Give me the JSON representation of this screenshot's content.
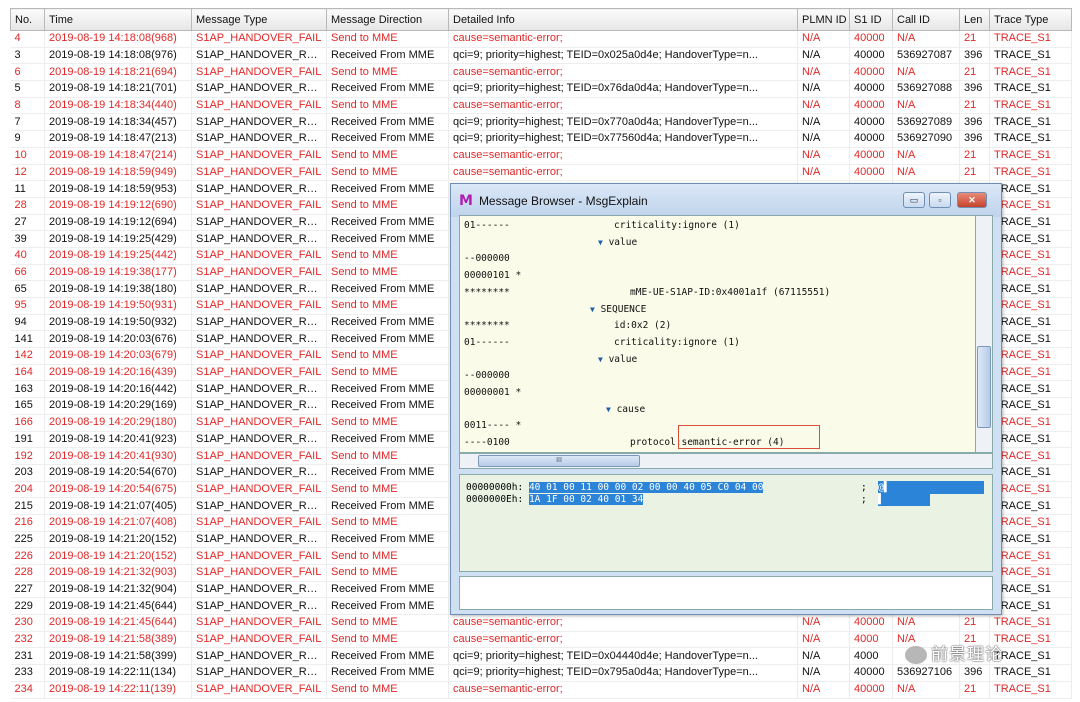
{
  "columns": [
    "No.",
    "Time",
    "Message Type",
    "Message Direction",
    "Detailed Info",
    "PLMN ID",
    "S1 ID",
    "Call ID",
    "Len",
    "Trace Type"
  ],
  "rows": [
    [
      "4",
      "2019-08-19 14:18:08(968)",
      "S1AP_HANDOVER_FAIL",
      "Send to MME",
      "cause=semantic-error;",
      "N/A",
      "40000",
      "N/A",
      "21",
      "TRACE_S1",
      "fail"
    ],
    [
      "3",
      "2019-08-19 14:18:08(976)",
      "S1AP_HANDOVER_REQ",
      "Received From MME",
      "qci=9; priority=highest; TEID=0x025a0d4e; HandoverType=n...",
      "N/A",
      "40000",
      "536927087",
      "396",
      "TRACE_S1",
      "req"
    ],
    [
      "6",
      "2019-08-19 14:18:21(694)",
      "S1AP_HANDOVER_FAIL",
      "Send to MME",
      "cause=semantic-error;",
      "N/A",
      "40000",
      "N/A",
      "21",
      "TRACE_S1",
      "fail"
    ],
    [
      "5",
      "2019-08-19 14:18:21(701)",
      "S1AP_HANDOVER_REQ",
      "Received From MME",
      "qci=9; priority=highest; TEID=0x76da0d4a; HandoverType=n...",
      "N/A",
      "40000",
      "536927088",
      "396",
      "TRACE_S1",
      "req"
    ],
    [
      "8",
      "2019-08-19 14:18:34(440)",
      "S1AP_HANDOVER_FAIL",
      "Send to MME",
      "cause=semantic-error;",
      "N/A",
      "40000",
      "N/A",
      "21",
      "TRACE_S1",
      "fail"
    ],
    [
      "7",
      "2019-08-19 14:18:34(457)",
      "S1AP_HANDOVER_REQ",
      "Received From MME",
      "qci=9; priority=highest; TEID=0x770a0d4a; HandoverType=n...",
      "N/A",
      "40000",
      "536927089",
      "396",
      "TRACE_S1",
      "req"
    ],
    [
      "9",
      "2019-08-19 14:18:47(213)",
      "S1AP_HANDOVER_REQ",
      "Received From MME",
      "qci=9; priority=highest; TEID=0x77560d4a; HandoverType=n...",
      "N/A",
      "40000",
      "536927090",
      "396",
      "TRACE_S1",
      "req"
    ],
    [
      "10",
      "2019-08-19 14:18:47(214)",
      "S1AP_HANDOVER_FAIL",
      "Send to MME",
      "cause=semantic-error;",
      "N/A",
      "40000",
      "N/A",
      "21",
      "TRACE_S1",
      "fail"
    ],
    [
      "12",
      "2019-08-19 14:18:59(949)",
      "S1AP_HANDOVER_FAIL",
      "Send to MME",
      "cause=semantic-error;",
      "N/A",
      "40000",
      "N/A",
      "21",
      "TRACE_S1",
      "fail"
    ],
    [
      "11",
      "2019-08-19 14:18:59(953)",
      "S1AP_HANDOVER_REQ",
      "Received From MME",
      "",
      "",
      "",
      "",
      "",
      "TRACE_S1",
      "req"
    ],
    [
      "28",
      "2019-08-19 14:19:12(690)",
      "S1AP_HANDOVER_FAIL",
      "Send to MME",
      "",
      "",
      "",
      "",
      "",
      "TRACE_S1",
      "fail"
    ],
    [
      "27",
      "2019-08-19 14:19:12(694)",
      "S1AP_HANDOVER_REQ",
      "Received From MME",
      "",
      "",
      "",
      "",
      "",
      "TRACE_S1",
      "req"
    ],
    [
      "39",
      "2019-08-19 14:19:25(429)",
      "S1AP_HANDOVER_REQ",
      "Received From MME",
      "",
      "",
      "",
      "",
      "",
      "TRACE_S1",
      "req"
    ],
    [
      "40",
      "2019-08-19 14:19:25(442)",
      "S1AP_HANDOVER_FAIL",
      "Send to MME",
      "",
      "",
      "",
      "",
      "",
      "TRACE_S1",
      "fail"
    ],
    [
      "66",
      "2019-08-19 14:19:38(177)",
      "S1AP_HANDOVER_FAIL",
      "Send to MME",
      "",
      "",
      "",
      "",
      "",
      "TRACE_S1",
      "fail"
    ],
    [
      "65",
      "2019-08-19 14:19:38(180)",
      "S1AP_HANDOVER_REQ",
      "Received From MME",
      "",
      "",
      "",
      "",
      "",
      "TRACE_S1",
      "req"
    ],
    [
      "95",
      "2019-08-19 14:19:50(931)",
      "S1AP_HANDOVER_FAIL",
      "Send to MME",
      "",
      "",
      "",
      "",
      "",
      "TRACE_S1",
      "fail"
    ],
    [
      "94",
      "2019-08-19 14:19:50(932)",
      "S1AP_HANDOVER_REQ",
      "Received From MME",
      "",
      "",
      "",
      "",
      "",
      "TRACE_S1",
      "req"
    ],
    [
      "141",
      "2019-08-19 14:20:03(676)",
      "S1AP_HANDOVER_REQ",
      "Received From MME",
      "",
      "",
      "",
      "",
      "",
      "TRACE_S1",
      "req"
    ],
    [
      "142",
      "2019-08-19 14:20:03(679)",
      "S1AP_HANDOVER_FAIL",
      "Send to MME",
      "",
      "",
      "",
      "",
      "",
      "TRACE_S1",
      "fail"
    ],
    [
      "164",
      "2019-08-19 14:20:16(439)",
      "S1AP_HANDOVER_FAIL",
      "Send to MME",
      "",
      "",
      "",
      "",
      "",
      "TRACE_S1",
      "fail"
    ],
    [
      "163",
      "2019-08-19 14:20:16(442)",
      "S1AP_HANDOVER_REQ",
      "Received From MME",
      "",
      "",
      "",
      "",
      "",
      "TRACE_S1",
      "req"
    ],
    [
      "165",
      "2019-08-19 14:20:29(169)",
      "S1AP_HANDOVER_REQ",
      "Received From MME",
      "",
      "",
      "",
      "",
      "",
      "TRACE_S1",
      "req"
    ],
    [
      "166",
      "2019-08-19 14:20:29(180)",
      "S1AP_HANDOVER_FAIL",
      "Send to MME",
      "",
      "",
      "",
      "",
      "",
      "TRACE_S1",
      "fail"
    ],
    [
      "191",
      "2019-08-19 14:20:41(923)",
      "S1AP_HANDOVER_REQ",
      "Received From MME",
      "",
      "",
      "",
      "",
      "",
      "TRACE_S1",
      "req"
    ],
    [
      "192",
      "2019-08-19 14:20:41(930)",
      "S1AP_HANDOVER_FAIL",
      "Send to MME",
      "",
      "",
      "",
      "",
      "",
      "TRACE_S1",
      "fail"
    ],
    [
      "203",
      "2019-08-19 14:20:54(670)",
      "S1AP_HANDOVER_REQ",
      "Received From MME",
      "",
      "",
      "",
      "",
      "",
      "TRACE_S1",
      "req"
    ],
    [
      "204",
      "2019-08-19 14:20:54(675)",
      "S1AP_HANDOVER_FAIL",
      "Send to MME",
      "",
      "",
      "",
      "",
      "",
      "TRACE_S1",
      "fail"
    ],
    [
      "215",
      "2019-08-19 14:21:07(405)",
      "S1AP_HANDOVER_REQ",
      "Received From MME",
      "",
      "",
      "",
      "",
      "",
      "TRACE_S1",
      "req"
    ],
    [
      "216",
      "2019-08-19 14:21:07(408)",
      "S1AP_HANDOVER_FAIL",
      "Send to MME",
      "",
      "",
      "",
      "",
      "",
      "TRACE_S1",
      "fail"
    ],
    [
      "225",
      "2019-08-19 14:21:20(152)",
      "S1AP_HANDOVER_REQ",
      "Received From MME",
      "",
      "",
      "",
      "",
      "",
      "TRACE_S1",
      "req"
    ],
    [
      "226",
      "2019-08-19 14:21:20(152)",
      "S1AP_HANDOVER_FAIL",
      "Send to MME",
      "",
      "",
      "",
      "",
      "",
      "TRACE_S1",
      "fail"
    ],
    [
      "228",
      "2019-08-19 14:21:32(903)",
      "S1AP_HANDOVER_FAIL",
      "Send to MME",
      "",
      "",
      "",
      "",
      "",
      "TRACE_S1",
      "fail"
    ],
    [
      "227",
      "2019-08-19 14:21:32(904)",
      "S1AP_HANDOVER_REQ",
      "Received From MME",
      "",
      "",
      "",
      "",
      "",
      "TRACE_S1",
      "req"
    ],
    [
      "229",
      "2019-08-19 14:21:45(644)",
      "S1AP_HANDOVER_REQ",
      "Received From MME",
      "",
      "",
      "",
      "",
      "",
      "TRACE_S1",
      "req"
    ],
    [
      "230",
      "2019-08-19 14:21:45(644)",
      "S1AP_HANDOVER_FAIL",
      "Send to MME",
      "cause=semantic-error;",
      "N/A",
      "40000",
      "N/A",
      "21",
      "TRACE_S1",
      "fail"
    ],
    [
      "232",
      "2019-08-19 14:21:58(389)",
      "S1AP_HANDOVER_FAIL",
      "Send to MME",
      "cause=semantic-error;",
      "N/A",
      "4000",
      "N/A",
      "21",
      "TRACE_S1",
      "fail"
    ],
    [
      "231",
      "2019-08-19 14:21:58(399)",
      "S1AP_HANDOVER_REQ",
      "Received From MME",
      "qci=9; priority=highest; TEID=0x04440d4e; HandoverType=n...",
      "N/A",
      "4000",
      "",
      "",
      "TRACE_S1",
      "req"
    ],
    [
      "233",
      "2019-08-19 14:22:11(134)",
      "S1AP_HANDOVER_REQ",
      "Received From MME",
      "qci=9; priority=highest; TEID=0x795a0d4a; HandoverType=n...",
      "N/A",
      "40000",
      "536927106",
      "396",
      "TRACE_S1",
      "req"
    ],
    [
      "234",
      "2019-08-19 14:22:11(139)",
      "S1AP_HANDOVER_FAIL",
      "Send to MME",
      "cause=semantic-error;",
      "N/A",
      "40000",
      "N/A",
      "21",
      "TRACE_S1",
      "fail"
    ]
  ],
  "browser": {
    "title": "Message Browser - MsgExplain",
    "minimize": "▭",
    "restore": "▫",
    "close": "✕",
    "tree": [
      {
        "bits": "01------",
        "indent": 150,
        "toggle": "",
        "text": "criticality:ignore (1)"
      },
      {
        "bits": "",
        "indent": 134,
        "toggle": "▼",
        "text": "value"
      },
      {
        "bits": "--000000",
        "indent": 0,
        "toggle": "",
        "text": ""
      },
      {
        "bits": "00000101 *",
        "indent": 0,
        "toggle": "",
        "text": ""
      },
      {
        "bits": "********",
        "indent": 166,
        "toggle": "",
        "text": "mME-UE-S1AP-ID:0x4001a1f (67115551)"
      },
      {
        "bits": "",
        "indent": 126,
        "toggle": "▼",
        "text": "SEQUENCE"
      },
      {
        "bits": "********",
        "indent": 150,
        "toggle": "",
        "text": "id:0x2 (2)"
      },
      {
        "bits": "01------",
        "indent": 150,
        "toggle": "",
        "text": "criticality:ignore (1)"
      },
      {
        "bits": "",
        "indent": 134,
        "toggle": "▼",
        "text": "value"
      },
      {
        "bits": "--000000",
        "indent": 0,
        "toggle": "",
        "text": ""
      },
      {
        "bits": "00000001 *",
        "indent": 0,
        "toggle": "",
        "text": ""
      },
      {
        "bits": "",
        "indent": 142,
        "toggle": "▼",
        "text": "cause"
      },
      {
        "bits": "0011---- *",
        "indent": 0,
        "toggle": "",
        "text": ""
      },
      {
        "bits": "----0100",
        "indent": 166,
        "toggle": "",
        "text": "protocol:semantic-error (4)"
      }
    ],
    "hscroll_grip": "III",
    "hex": [
      {
        "addr": "00000000h:",
        "bytes": "40 01 00 11 00 00 02 00 00 40 05 C0 04 00",
        "ascii": "@▌"
      },
      {
        "addr": "0000000Eh:",
        "bytes": "1A 1F 00 02 40 01 34",
        "ascii": "▌"
      }
    ]
  },
  "watermark": "前景理论"
}
